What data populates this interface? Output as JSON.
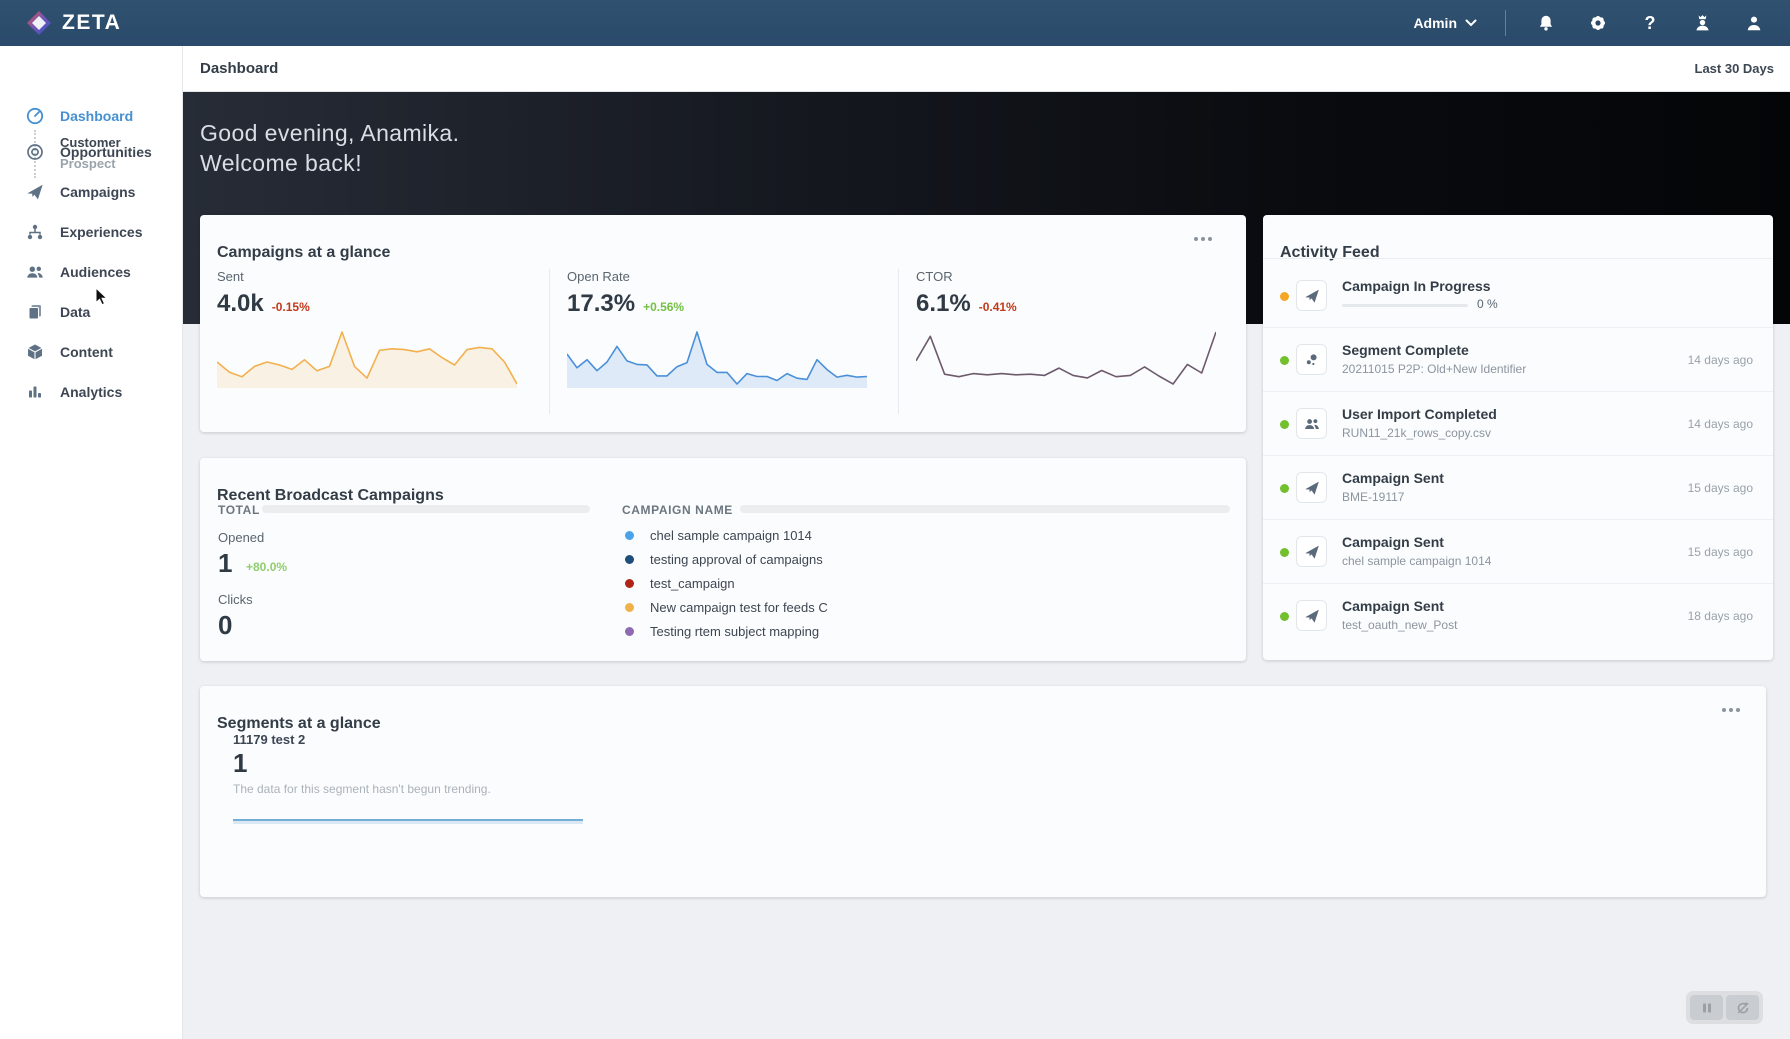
{
  "navbar": {
    "brand": "ZETA",
    "admin_label": "Admin",
    "icons": [
      "bell-icon",
      "gear-icon",
      "help-icon",
      "impersonate-user-icon",
      "profile-icon"
    ]
  },
  "sidebar": {
    "items": [
      {
        "label": "Dashboard",
        "icon": "speedometer-icon",
        "active": true
      },
      {
        "label": "Customer"
      },
      {
        "label": "Prospect"
      },
      {
        "label": "Opportunities",
        "icon": "target-icon"
      },
      {
        "label": "Campaigns",
        "icon": "paper-plane-icon"
      },
      {
        "label": "Experiences",
        "icon": "sitemap-icon"
      },
      {
        "label": "Audiences",
        "icon": "people-icon"
      },
      {
        "label": "Data",
        "icon": "documents-icon"
      },
      {
        "label": "Content",
        "icon": "cube-icon"
      },
      {
        "label": "Analytics",
        "icon": "bar-chart-icon"
      }
    ]
  },
  "header": {
    "title": "Dashboard",
    "date_range": "Last 30 Days"
  },
  "hero": {
    "greeting_line1": "Good evening, Anamika.",
    "greeting_line2": "Welcome back!"
  },
  "campaigns_glance": {
    "title": "Campaigns at a glance",
    "stats": [
      {
        "label": "Sent",
        "value": "4.0k",
        "delta": "-0.15%",
        "direction": "down"
      },
      {
        "label": "Open Rate",
        "value": "17.3%",
        "delta": "+0.56%",
        "direction": "up"
      },
      {
        "label": "CTOR",
        "value": "6.1%",
        "delta": "-0.41%",
        "direction": "down"
      }
    ]
  },
  "activity_feed": {
    "title": "Activity Feed",
    "items": [
      {
        "title": "Campaign In Progress",
        "icon": "paper-plane-icon",
        "dot_color": "#f5a623",
        "progress_label": "0 %",
        "progress_percent": 0,
        "time": ""
      },
      {
        "title": "Segment Complete",
        "subtitle": "20211015 P2P: Old+New Identifier",
        "icon": "segment-dots-icon",
        "dot_color": "#72c02c",
        "time": "14 days ago"
      },
      {
        "title": "User Import Completed",
        "subtitle": "RUN11_21k_rows_copy.csv",
        "icon": "people-icon",
        "dot_color": "#72c02c",
        "time": "14 days ago"
      },
      {
        "title": "Campaign Sent",
        "subtitle": "BME-19117",
        "icon": "paper-plane-icon",
        "dot_color": "#72c02c",
        "time": "15 days ago"
      },
      {
        "title": "Campaign Sent",
        "subtitle": "chel sample campaign 1014",
        "icon": "paper-plane-icon",
        "dot_color": "#72c02c",
        "time": "15 days ago"
      },
      {
        "title": "Campaign Sent",
        "subtitle": "test_oauth_new_Post",
        "icon": "paper-plane-icon",
        "dot_color": "#72c02c",
        "time": "18 days ago"
      }
    ]
  },
  "recent_broadcast": {
    "title": "Recent Broadcast Campaigns",
    "total_header": "TOTAL",
    "campaign_name_header": "CAMPAIGN NAME",
    "opened_label": "Opened",
    "opened_value": "1",
    "opened_delta": "+80.0%",
    "clicks_label": "Clicks",
    "clicks_value": "0",
    "campaigns": [
      {
        "name": "chel sample campaign 1014",
        "color": "#4aa3e8"
      },
      {
        "name": "testing approval of campaigns",
        "color": "#1e4e79"
      },
      {
        "name": "test_campaign",
        "color": "#b02418"
      },
      {
        "name": "New campaign test for feeds C",
        "color": "#f0b04a"
      },
      {
        "name": "Testing rtem subject mapping",
        "color": "#8e6bb0"
      }
    ]
  },
  "segments_glance": {
    "title": "Segments at a glance",
    "segment_name": "11179 test 2",
    "segment_value": "1",
    "segment_note": "The data for this segment hasn't begun trending."
  },
  "controls": {
    "icons": [
      "pause-icon",
      "sync-disabled-icon"
    ]
  },
  "colors": {
    "accent_blue": "#4590d2",
    "delta_up_green": "#74c045",
    "delta_down_red": "#c2391a",
    "activity_green": "#72c02c",
    "activity_orange": "#f5a623"
  },
  "chart_data": [
    {
      "type": "line",
      "name": "Sent sparkline (last 30 days, relative)",
      "color": "#f2b04e",
      "fill": "rgba(242,176,78,0.14)",
      "values": [
        52,
        38,
        32,
        46,
        52,
        48,
        42,
        55,
        40,
        46,
        93,
        46,
        30,
        68,
        70,
        69,
        66,
        70,
        58,
        48,
        69,
        72,
        70,
        52,
        22
      ]
    },
    {
      "type": "line",
      "name": "Open Rate sparkline (last 30 days, relative)",
      "color": "#4a90d9",
      "fill": "rgba(74,144,217,0.16)",
      "values": [
        62,
        38,
        52,
        33,
        48,
        75,
        50,
        44,
        43,
        24,
        24,
        40,
        47,
        100,
        44,
        30,
        30,
        10,
        28,
        23,
        23,
        16,
        28,
        20,
        18,
        52,
        35,
        22,
        25,
        22,
        23
      ]
    },
    {
      "type": "line",
      "name": "CTOR sparkline (last 30 days, relative)",
      "color": "#6d5a6d",
      "fill": "none",
      "values": [
        48,
        88,
        26,
        22,
        27,
        25,
        27,
        25,
        26,
        24,
        36,
        24,
        20,
        32,
        22,
        24,
        38,
        23,
        10,
        42,
        28,
        95
      ]
    },
    {
      "type": "line",
      "name": "Segment 11179 test 2 trend (flat, not trending)",
      "color": "#74add6",
      "fill": "rgba(116,173,214,0.25)",
      "values": [
        1,
        1,
        1,
        1,
        1,
        1,
        1,
        1
      ]
    }
  ]
}
